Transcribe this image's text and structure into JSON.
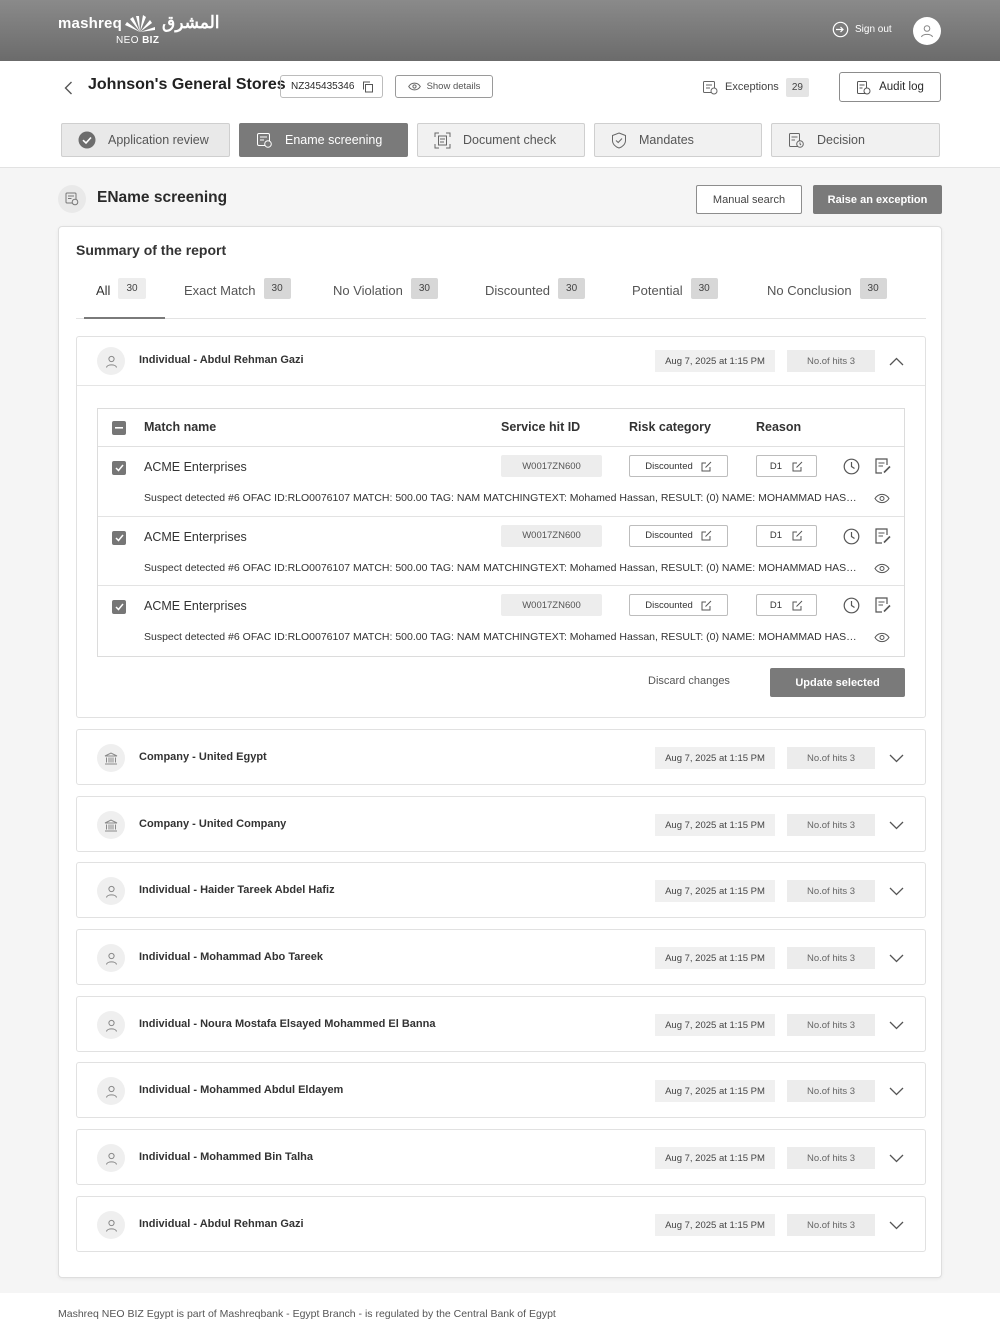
{
  "brand": {
    "name_en": "mashreq",
    "name_ar": "المشرق",
    "sub": "NEO",
    "sub_bold": "BIZ"
  },
  "topbar": {
    "signout_label": "Sign out"
  },
  "header": {
    "company_name": "Johnson's General Stores",
    "customer_id": "NZ345435346",
    "show_details_label": "Show details",
    "exceptions_label": "Exceptions",
    "exceptions_count": "29",
    "audit_log_label": "Audit log"
  },
  "steps": [
    {
      "label": "Application review",
      "icon": "check-circle-icon",
      "state": "done"
    },
    {
      "label": "Ename screening",
      "icon": "screening-icon",
      "state": "active"
    },
    {
      "label": "Document check",
      "icon": "document-scan-icon",
      "state": "pending"
    },
    {
      "label": "Mandates",
      "icon": "shield-check-icon",
      "state": "pending"
    },
    {
      "label": "Decision",
      "icon": "decision-doc-icon",
      "state": "pending"
    }
  ],
  "section": {
    "title": "EName screening",
    "manual_search_label": "Manual search",
    "raise_exception_label": "Raise an exception"
  },
  "summary": {
    "title": "Summary of the report",
    "filters": [
      {
        "label": "All",
        "count": "30",
        "active": true
      },
      {
        "label": "Exact Match",
        "count": "30"
      },
      {
        "label": "No Violation",
        "count": "30"
      },
      {
        "label": "Discounted",
        "count": "30"
      },
      {
        "label": "Potential",
        "count": "30"
      },
      {
        "label": "No Conclusion",
        "count": "30"
      }
    ]
  },
  "table": {
    "headers": {
      "match_name": "Match name",
      "service_hit_id": "Service hit ID",
      "risk_category": "Risk category",
      "reason": "Reason"
    },
    "rows": [
      {
        "match_name": "ACME Enterprises",
        "hit_id": "W0017ZN600",
        "risk": "Discounted",
        "reason": "D1",
        "description": "Suspect detected #6 OFAC ID:RLO0076107 MATCH: 500.00 TAG: NAM MATCHINGTEXT: Mohamed Hassan, RESULT: (0) NAME: MOHAMMAD HASA..."
      },
      {
        "match_name": "ACME Enterprises",
        "hit_id": "W0017ZN600",
        "risk": "Discounted",
        "reason": "D1",
        "description": "Suspect detected #6 OFAC ID:RLO0076107 MATCH: 500.00 TAG: NAM MATCHINGTEXT: Mohamed Hassan, RESULT: (0) NAME: MOHAMMAD HASA..."
      },
      {
        "match_name": "ACME Enterprises",
        "hit_id": "W0017ZN600",
        "risk": "Discounted",
        "reason": "D1",
        "description": "Suspect detected #6 OFAC ID:RLO0076107 MATCH: 500.00 TAG: NAM MATCHINGTEXT: Mohamed Hassan, RESULT: (0) NAME: MOHAMMAD HASA..."
      }
    ],
    "discard_label": "Discard changes",
    "update_label": "Update selected"
  },
  "entities": [
    {
      "name": "Individual - Abdul Rehman Gazi",
      "type": "person-icon",
      "date": "Aug 7, 2025 at 1:15 PM",
      "hits": "No.of hits 3",
      "expanded": true
    },
    {
      "name": "Company - United Egypt",
      "type": "bank-icon",
      "date": "Aug 7, 2025 at 1:15 PM",
      "hits": "No.of hits 3"
    },
    {
      "name": "Company - United Company",
      "type": "bank-icon",
      "date": "Aug 7, 2025 at 1:15 PM",
      "hits": "No.of hits 3"
    },
    {
      "name": "Individual - Haider Tareek Abdel Hafiz",
      "type": "person-icon",
      "date": "Aug 7, 2025 at 1:15 PM",
      "hits": "No.of hits 3"
    },
    {
      "name": "Individual - Mohammad Abo Tareek",
      "type": "person-icon",
      "date": "Aug 7, 2025 at 1:15 PM",
      "hits": "No.of hits 3"
    },
    {
      "name": "Individual - Noura Mostafa Elsayed Mohammed El Banna",
      "type": "person-icon",
      "date": "Aug 7, 2025 at 1:15 PM",
      "hits": "No.of hits 3"
    },
    {
      "name": "Individual - Mohammed Abdul Eldayem",
      "type": "person-icon",
      "date": "Aug 7, 2025 at 1:15 PM",
      "hits": "No.of hits 3"
    },
    {
      "name": "Individual - Mohammed Bin Talha",
      "type": "person-icon",
      "date": "Aug 7, 2025 at 1:15 PM",
      "hits": "No.of hits 3"
    },
    {
      "name": "Individual - Abdul Rehman Gazi",
      "type": "person-icon",
      "date": "Aug 7, 2025 at 1:15 PM",
      "hits": "No.of hits 3"
    }
  ],
  "footer": {
    "text": "Mashreq NEO BIZ Egypt is part of Mashreqbank - Egypt Branch - is regulated by the Central Bank of Egypt"
  }
}
